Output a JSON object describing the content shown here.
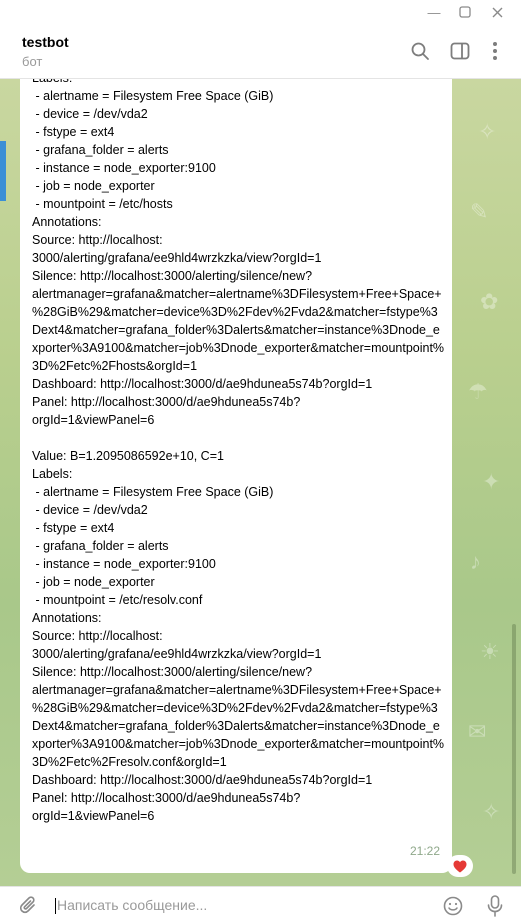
{
  "window": {
    "minimize_glyph": "—",
    "maximize_glyph": "☐",
    "close_glyph": "✕"
  },
  "header": {
    "title": "testbot",
    "subtitle": "бот",
    "icons": [
      "search-icon",
      "sidebar-toggle-icon",
      "more-vertical-icon"
    ]
  },
  "message": {
    "text": "Labels:\n - alertname = Filesystem Free Space (GiB)\n - device = /dev/vda2\n - fstype = ext4\n - grafana_folder = alerts\n - instance = node_exporter:9100\n - job = node_exporter\n - mountpoint = /etc/hosts\nAnnotations:\nSource: http://localhost:\n3000/alerting/grafana/ee9hld4wrzkzka/view?orgId=1\nSilence: http://localhost:3000/alerting/silence/new?\nalertmanager=grafana&matcher=alertname%3DFilesystem+Free+Space+\n%28GiB%29&matcher=device%3D%2Fdev%2Fvda2&matcher=fstype%3Dext4&matcher=grafana_folder%3Dalerts&matcher=instance%3Dnode_exporter%3A9100&matcher=job%3Dnode_exporter&matcher=mountpoint%3D%2Fetc%2Fhosts&orgId=1\nDashboard: http://localhost:3000/d/ae9hdunea5s74b?orgId=1\nPanel: http://localhost:3000/d/ae9hdunea5s74b?\norgId=1&viewPanel=6\n\nValue: B=1.2095086592e+10, C=1\nLabels:\n - alertname = Filesystem Free Space (GiB)\n - device = /dev/vda2\n - fstype = ext4\n - grafana_folder = alerts\n - instance = node_exporter:9100\n - job = node_exporter\n - mountpoint = /etc/resolv.conf\nAnnotations:\nSource: http://localhost:\n3000/alerting/grafana/ee9hld4wrzkzka/view?orgId=1\nSilence: http://localhost:3000/alerting/silence/new?\nalertmanager=grafana&matcher=alertname%3DFilesystem+Free+Space+\n%28GiB%29&matcher=device%3D%2Fdev%2Fvda2&matcher=fstype%3Dext4&matcher=grafana_folder%3Dalerts&matcher=instance%3Dnode_exporter%3A9100&matcher=job%3Dnode_exporter&matcher=mountpoint%3D%2Fetc%2Fresolv.conf&orgId=1\nDashboard: http://localhost:3000/d/ae9hdunea5s74b?orgId=1\nPanel: http://localhost:3000/d/ae9hdunea5s74b?\norgId=1&viewPanel=6",
    "time": "21:22",
    "reaction": "❤️"
  },
  "composer": {
    "placeholder": "Написать сообщение...",
    "value": ""
  },
  "colors": {
    "chat_bg": "#b9cf8e",
    "bubble_bg": "#ffffff",
    "accent": "#3a8fd6",
    "time_color": "#8fa88a",
    "reaction_heart": "#e53935"
  }
}
